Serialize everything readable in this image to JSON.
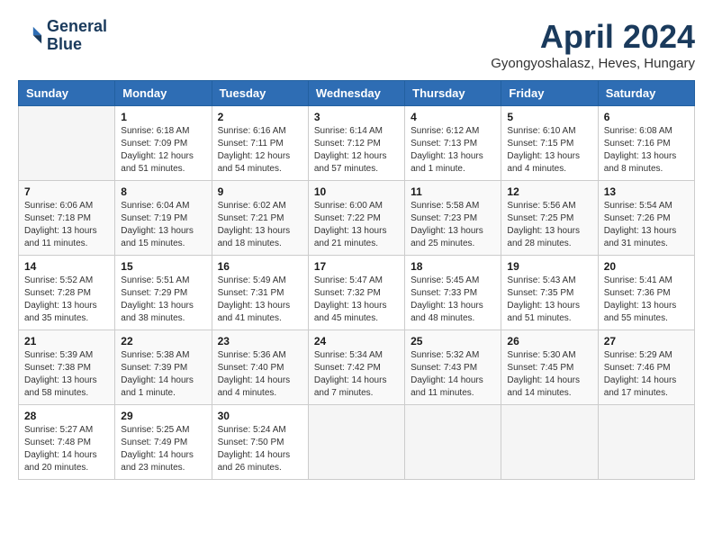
{
  "logo": {
    "line1": "General",
    "line2": "Blue"
  },
  "title": "April 2024",
  "subtitle": "Gyongyoshalasz, Heves, Hungary",
  "days_of_week": [
    "Sunday",
    "Monday",
    "Tuesday",
    "Wednesday",
    "Thursday",
    "Friday",
    "Saturday"
  ],
  "weeks": [
    [
      {
        "num": "",
        "info": ""
      },
      {
        "num": "1",
        "info": "Sunrise: 6:18 AM\nSunset: 7:09 PM\nDaylight: 12 hours\nand 51 minutes."
      },
      {
        "num": "2",
        "info": "Sunrise: 6:16 AM\nSunset: 7:11 PM\nDaylight: 12 hours\nand 54 minutes."
      },
      {
        "num": "3",
        "info": "Sunrise: 6:14 AM\nSunset: 7:12 PM\nDaylight: 12 hours\nand 57 minutes."
      },
      {
        "num": "4",
        "info": "Sunrise: 6:12 AM\nSunset: 7:13 PM\nDaylight: 13 hours\nand 1 minute."
      },
      {
        "num": "5",
        "info": "Sunrise: 6:10 AM\nSunset: 7:15 PM\nDaylight: 13 hours\nand 4 minutes."
      },
      {
        "num": "6",
        "info": "Sunrise: 6:08 AM\nSunset: 7:16 PM\nDaylight: 13 hours\nand 8 minutes."
      }
    ],
    [
      {
        "num": "7",
        "info": "Sunrise: 6:06 AM\nSunset: 7:18 PM\nDaylight: 13 hours\nand 11 minutes."
      },
      {
        "num": "8",
        "info": "Sunrise: 6:04 AM\nSunset: 7:19 PM\nDaylight: 13 hours\nand 15 minutes."
      },
      {
        "num": "9",
        "info": "Sunrise: 6:02 AM\nSunset: 7:21 PM\nDaylight: 13 hours\nand 18 minutes."
      },
      {
        "num": "10",
        "info": "Sunrise: 6:00 AM\nSunset: 7:22 PM\nDaylight: 13 hours\nand 21 minutes."
      },
      {
        "num": "11",
        "info": "Sunrise: 5:58 AM\nSunset: 7:23 PM\nDaylight: 13 hours\nand 25 minutes."
      },
      {
        "num": "12",
        "info": "Sunrise: 5:56 AM\nSunset: 7:25 PM\nDaylight: 13 hours\nand 28 minutes."
      },
      {
        "num": "13",
        "info": "Sunrise: 5:54 AM\nSunset: 7:26 PM\nDaylight: 13 hours\nand 31 minutes."
      }
    ],
    [
      {
        "num": "14",
        "info": "Sunrise: 5:52 AM\nSunset: 7:28 PM\nDaylight: 13 hours\nand 35 minutes."
      },
      {
        "num": "15",
        "info": "Sunrise: 5:51 AM\nSunset: 7:29 PM\nDaylight: 13 hours\nand 38 minutes."
      },
      {
        "num": "16",
        "info": "Sunrise: 5:49 AM\nSunset: 7:31 PM\nDaylight: 13 hours\nand 41 minutes."
      },
      {
        "num": "17",
        "info": "Sunrise: 5:47 AM\nSunset: 7:32 PM\nDaylight: 13 hours\nand 45 minutes."
      },
      {
        "num": "18",
        "info": "Sunrise: 5:45 AM\nSunset: 7:33 PM\nDaylight: 13 hours\nand 48 minutes."
      },
      {
        "num": "19",
        "info": "Sunrise: 5:43 AM\nSunset: 7:35 PM\nDaylight: 13 hours\nand 51 minutes."
      },
      {
        "num": "20",
        "info": "Sunrise: 5:41 AM\nSunset: 7:36 PM\nDaylight: 13 hours\nand 55 minutes."
      }
    ],
    [
      {
        "num": "21",
        "info": "Sunrise: 5:39 AM\nSunset: 7:38 PM\nDaylight: 13 hours\nand 58 minutes."
      },
      {
        "num": "22",
        "info": "Sunrise: 5:38 AM\nSunset: 7:39 PM\nDaylight: 14 hours\nand 1 minute."
      },
      {
        "num": "23",
        "info": "Sunrise: 5:36 AM\nSunset: 7:40 PM\nDaylight: 14 hours\nand 4 minutes."
      },
      {
        "num": "24",
        "info": "Sunrise: 5:34 AM\nSunset: 7:42 PM\nDaylight: 14 hours\nand 7 minutes."
      },
      {
        "num": "25",
        "info": "Sunrise: 5:32 AM\nSunset: 7:43 PM\nDaylight: 14 hours\nand 11 minutes."
      },
      {
        "num": "26",
        "info": "Sunrise: 5:30 AM\nSunset: 7:45 PM\nDaylight: 14 hours\nand 14 minutes."
      },
      {
        "num": "27",
        "info": "Sunrise: 5:29 AM\nSunset: 7:46 PM\nDaylight: 14 hours\nand 17 minutes."
      }
    ],
    [
      {
        "num": "28",
        "info": "Sunrise: 5:27 AM\nSunset: 7:48 PM\nDaylight: 14 hours\nand 20 minutes."
      },
      {
        "num": "29",
        "info": "Sunrise: 5:25 AM\nSunset: 7:49 PM\nDaylight: 14 hours\nand 23 minutes."
      },
      {
        "num": "30",
        "info": "Sunrise: 5:24 AM\nSunset: 7:50 PM\nDaylight: 14 hours\nand 26 minutes."
      },
      {
        "num": "",
        "info": ""
      },
      {
        "num": "",
        "info": ""
      },
      {
        "num": "",
        "info": ""
      },
      {
        "num": "",
        "info": ""
      }
    ]
  ]
}
